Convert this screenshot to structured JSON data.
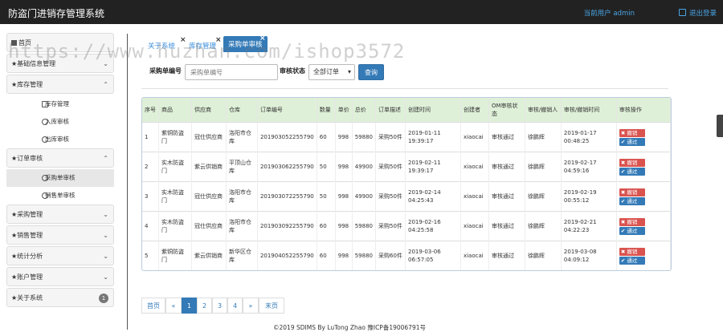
{
  "header": {
    "title": "防盗门进销存管理系统",
    "user_label": "当前用户 admin",
    "logout_label": "退出登录"
  },
  "sidebar": {
    "items": [
      {
        "label": "首页"
      },
      {
        "label": "★基础信息管理"
      },
      {
        "label": "★库存管理"
      },
      {
        "label": "★订单审核"
      },
      {
        "label": "★采购管理"
      },
      {
        "label": "★销售管理"
      },
      {
        "label": "★统计分析"
      },
      {
        "label": "★账户管理"
      },
      {
        "label": "★关于系统",
        "badge": "1"
      }
    ],
    "inventory_sub": [
      "库存管理",
      "入库审核",
      "出库审核"
    ],
    "order_sub": [
      "采购单审核",
      "销售单审核"
    ]
  },
  "tabs": [
    "关于系统",
    "库存管理",
    "采购单审核"
  ],
  "search": {
    "label": "采购单编号",
    "placeholder": "采购单编号",
    "status_label": "审核状态",
    "status_value": "全部订单",
    "query_label": "查询"
  },
  "table": {
    "headers": [
      "序号",
      "商品",
      "供应商",
      "仓库",
      "订单编号",
      "数量",
      "单价",
      "总价",
      "订单描述",
      "创建时间",
      "创建者",
      "OM审核状态",
      "审核/撤销人",
      "审核/撤销时间",
      "审核操作"
    ],
    "rows": [
      [
        "1",
        "紫铜防盗门",
        "冠仕供应商",
        "洛阳市仓库",
        "201903052255790",
        "60",
        "998",
        "59880",
        "采购50件",
        "2019-01-11 19:39:17",
        "xiaocai",
        "审核通过",
        "徐鹏辉",
        "2019-01-17 00:48:25"
      ],
      [
        "2",
        "实木防盗门",
        "紫云供销商",
        "平顶山仓库",
        "201903062255790",
        "50",
        "998",
        "49900",
        "采购50件",
        "2019-02-11 19:39:17",
        "xiaocai",
        "审核通过",
        "徐鹏辉",
        "2019-02-17 04:59:16"
      ],
      [
        "3",
        "实木防盗门",
        "冠仕供应商",
        "洛阳市仓库",
        "201903072255790",
        "50",
        "998",
        "49900",
        "采购50件",
        "2019-02-14 04:25:43",
        "xiaocai",
        "审核通过",
        "徐鹏辉",
        "2019-02-19 00:55:12"
      ],
      [
        "4",
        "实木防盗门",
        "冠仕供应商",
        "洛阳市仓库",
        "201903092255790",
        "60",
        "998",
        "59880",
        "采购50件",
        "2019-02-16 04:25:58",
        "xiaocai",
        "审核通过",
        "徐鹏辉",
        "2019-02-21 04:22:23"
      ],
      [
        "5",
        "紫铜防盗门",
        "紫云供销商",
        "新华区仓库",
        "201904052255790",
        "60",
        "998",
        "59880",
        "采购60件",
        "2019-03-06 06:57:05",
        "xiaocai",
        "审核通过",
        "徐鹏辉",
        "2019-03-08 04:09:12"
      ]
    ],
    "revoke_label": "撤销",
    "approve_label": "通过"
  },
  "pager": [
    "首页",
    "«",
    "1",
    "2",
    "3",
    "4",
    "»",
    "末页"
  ],
  "footer": "©2019 SDIMS By LuTong Zhao 豫ICP备19006791号",
  "watermark": "https://www.huzhan.com/ishop3572"
}
